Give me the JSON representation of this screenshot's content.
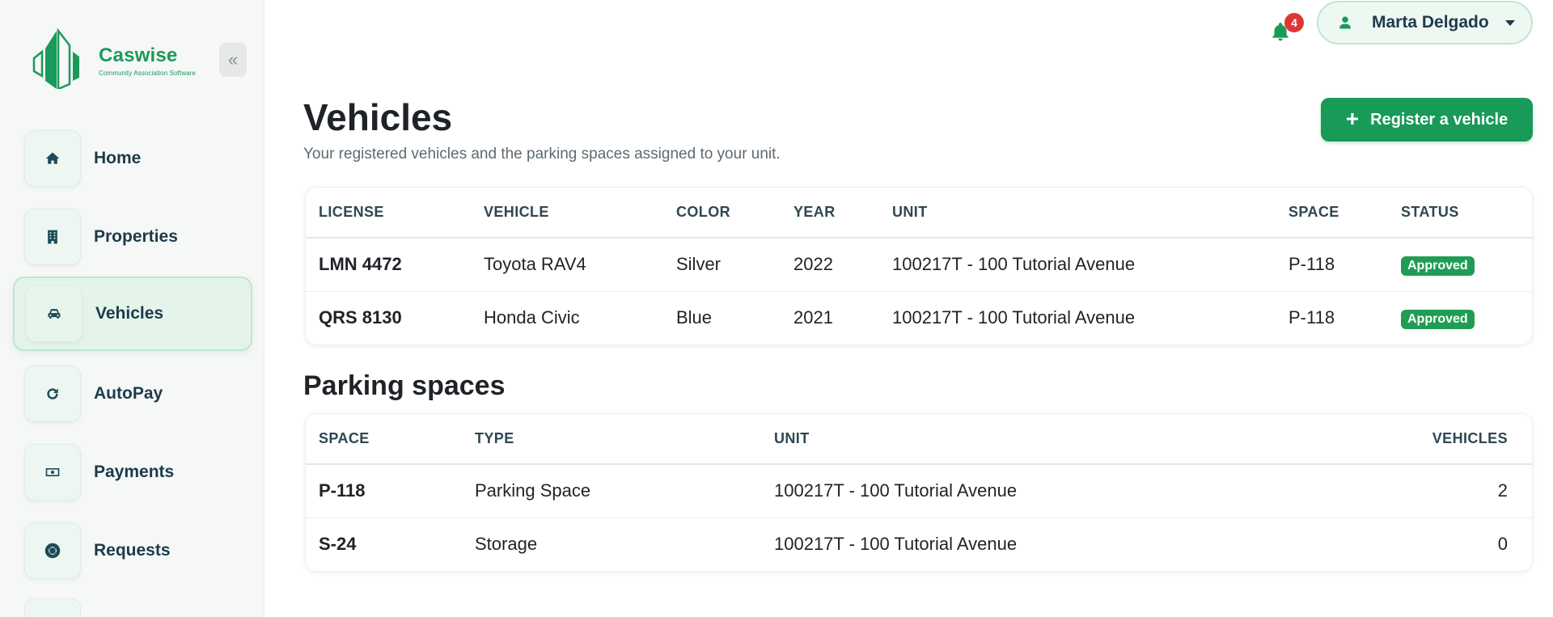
{
  "brand": {
    "name": "Caswise",
    "tagline": "Community Association Software",
    "accent": "#1a9a5a"
  },
  "sidebar": {
    "collapse_icon": "chevron-double-left-icon",
    "items": [
      {
        "label": "Home",
        "icon": "home-icon"
      },
      {
        "label": "Properties",
        "icon": "building-icon"
      },
      {
        "label": "Vehicles",
        "icon": "car-icon",
        "active": true
      },
      {
        "label": "AutoPay",
        "icon": "refresh-icon"
      },
      {
        "label": "Payments",
        "icon": "money-icon"
      },
      {
        "label": "Requests",
        "icon": "lifebuoy-icon"
      }
    ]
  },
  "topbar": {
    "notification_count": "4",
    "user_name": "Marta Delgado"
  },
  "header": {
    "title": "Vehicles",
    "subtitle": "Your registered vehicles and the parking spaces assigned to your unit.",
    "register_label": "Register a vehicle"
  },
  "vehicles_table": {
    "columns": [
      "LICENSE",
      "VEHICLE",
      "COLOR",
      "YEAR",
      "UNIT",
      "SPACE",
      "STATUS"
    ],
    "rows": [
      {
        "license": "LMN 4472",
        "vehicle": "Toyota RAV4",
        "color": "Silver",
        "year": "2022",
        "unit": "100217T - 100 Tutorial Avenue",
        "space": "P-118",
        "status": "Approved"
      },
      {
        "license": "QRS 8130",
        "vehicle": "Honda Civic",
        "color": "Blue",
        "year": "2021",
        "unit": "100217T - 100 Tutorial Avenue",
        "space": "P-118",
        "status": "Approved"
      }
    ]
  },
  "parking": {
    "title": "Parking spaces",
    "columns": [
      "SPACE",
      "TYPE",
      "UNIT",
      "VEHICLES"
    ],
    "rows": [
      {
        "space": "P-118",
        "type": "Parking Space",
        "unit": "100217T - 100 Tutorial Avenue",
        "vehicles": "2"
      },
      {
        "space": "S-24",
        "type": "Storage",
        "unit": "100217T - 100 Tutorial Avenue",
        "vehicles": "0"
      }
    ]
  }
}
